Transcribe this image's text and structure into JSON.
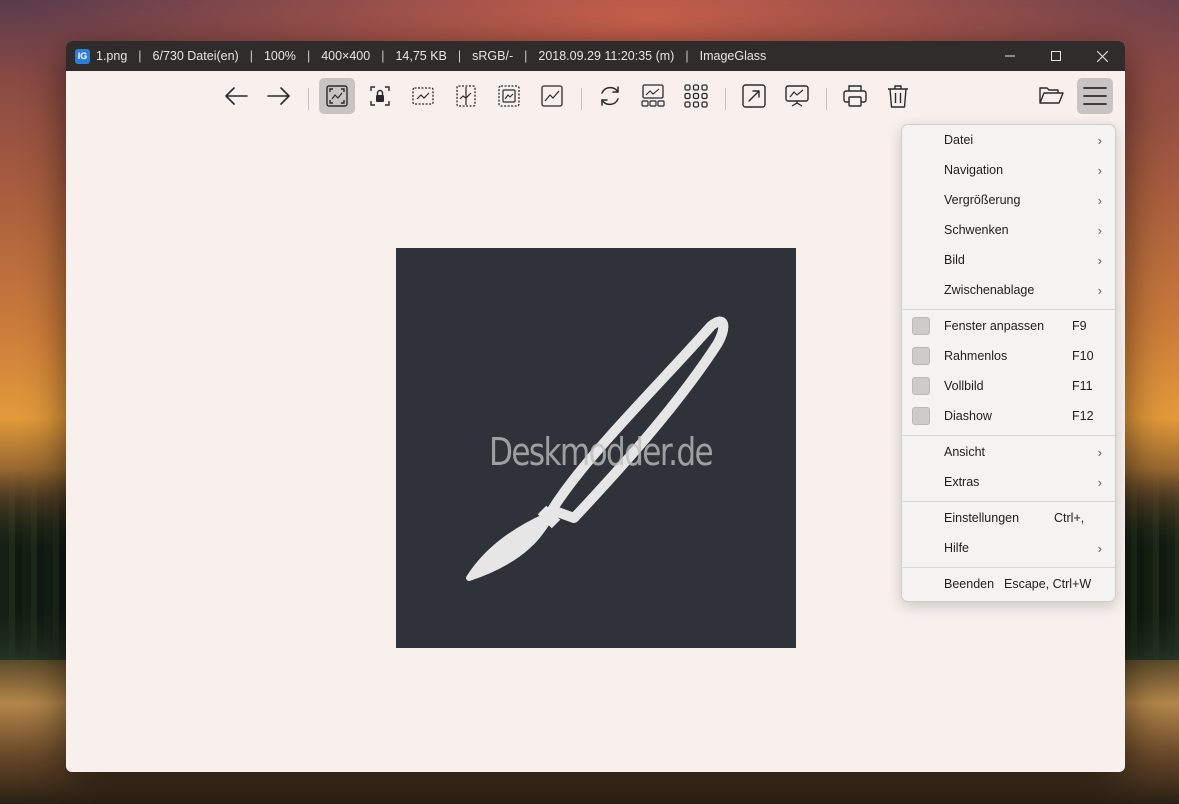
{
  "titlebar": {
    "app_icon_text": "IG",
    "filename": "1.png",
    "file_index": "6/730 Datei(en)",
    "zoom": "100%",
    "dimensions": "400×400",
    "filesize": "14,75 KB",
    "colorspace": "sRGB/-",
    "datetime": "2018.09.29 11:20:35 (m)",
    "appname": "ImageGlass",
    "separator": "|"
  },
  "toolbar": {
    "icons": [
      "arrow-left-icon",
      "arrow-right-icon",
      "auto-zoom-icon",
      "lock-zoom-icon",
      "scale-to-width-icon",
      "scale-to-height-icon",
      "scale-to-fit-icon",
      "scale-to-fill-icon",
      "refresh-icon",
      "gallery-icon",
      "thumbnail-grid-icon",
      "fullscreen-icon",
      "slideshow-icon",
      "print-icon",
      "delete-icon",
      "open-folder-icon",
      "main-menu-icon"
    ],
    "active": "auto-zoom-icon"
  },
  "image": {
    "background": "#2f3238",
    "watermark": "Deskmodder.de"
  },
  "menu": {
    "groups": [
      [
        {
          "label": "Datei",
          "submenu": true
        },
        {
          "label": "Navigation",
          "submenu": true
        },
        {
          "label": "Vergrößerung",
          "submenu": true
        },
        {
          "label": "Schwenken",
          "submenu": true
        },
        {
          "label": "Bild",
          "submenu": true
        },
        {
          "label": "Zwischenablage",
          "submenu": true
        }
      ],
      [
        {
          "label": "Fenster anpassen",
          "shortcut": "F9",
          "checkbox": true
        },
        {
          "label": "Rahmenlos",
          "shortcut": "F10",
          "checkbox": true
        },
        {
          "label": "Vollbild",
          "shortcut": "F11",
          "checkbox": true
        },
        {
          "label": "Diashow",
          "shortcut": "F12",
          "checkbox": true
        }
      ],
      [
        {
          "label": "Ansicht",
          "submenu": true
        },
        {
          "label": "Extras",
          "submenu": true
        }
      ],
      [
        {
          "label": "Einstellungen",
          "shortcut": "Ctrl+,"
        },
        {
          "label": "Hilfe",
          "submenu": true
        }
      ],
      [
        {
          "label": "Beenden",
          "shortcut": "Escape, Ctrl+W"
        }
      ]
    ],
    "chevron": "›"
  },
  "colors": {
    "titlebar_bg": "#2f2c2b",
    "window_bg": "#f7f0ed",
    "menu_bg": "#f5f3f2",
    "accent_icon": "#2d7fd6"
  }
}
